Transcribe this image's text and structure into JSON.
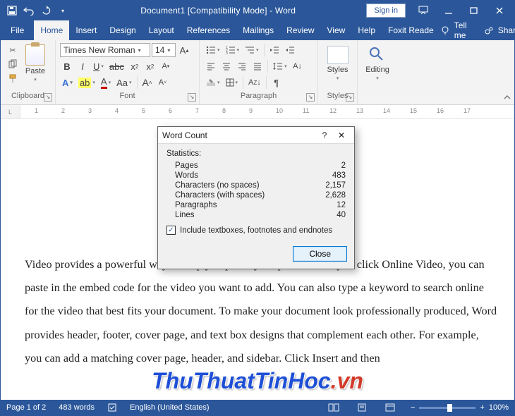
{
  "titlebar": {
    "title": "Document1 [Compatibility Mode]  -  Word",
    "signin": "Sign in"
  },
  "tabs": {
    "file": "File",
    "home": "Home",
    "insert": "Insert",
    "design": "Design",
    "layout": "Layout",
    "references": "References",
    "mailings": "Mailings",
    "review": "Review",
    "view": "View",
    "help": "Help",
    "foxit": "Foxit Reade",
    "tellme": "Tell me",
    "share": "Share"
  },
  "ribbon": {
    "clipboard": {
      "paste": "Paste",
      "label": "Clipboard"
    },
    "font": {
      "name": "Times New Roman",
      "size": "14",
      "label": "Font"
    },
    "paragraph": {
      "label": "Paragraph"
    },
    "styles": {
      "big": "Styles",
      "label": "Styles"
    },
    "editing": {
      "big": "Editing"
    }
  },
  "dialog": {
    "title": "Word Count",
    "statistics": "Statistics:",
    "rows": {
      "pages": {
        "label": "Pages",
        "value": "2"
      },
      "words": {
        "label": "Words",
        "value": "483"
      },
      "chars_nospace": {
        "label": "Characters (no spaces)",
        "value": "2,157"
      },
      "chars_space": {
        "label": "Characters (with spaces)",
        "value": "2,628"
      },
      "paragraphs": {
        "label": "Paragraphs",
        "value": "12"
      },
      "lines": {
        "label": "Lines",
        "value": "40"
      }
    },
    "checkbox": "Include textboxes, footnotes and endnotes",
    "close": "Close"
  },
  "document": {
    "body": "Video provides a powerful way to help you prove your point. When you click Online Video, you can paste in the embed code for the video you want to add. You can also type a keyword to search online for the video that best fits your document. To make your document look professionally produced, Word provides header, footer, cover page, and text box designs that complement each other. For example, you can add a matching cover page, header, and sidebar. Click Insert and then"
  },
  "watermark": {
    "a": "ThuThuatTinHoc",
    "b": ".vn"
  },
  "status": {
    "page": "Page 1 of 2",
    "words": "483 words",
    "lang": "English (United States)",
    "zoom": "100%"
  },
  "ruler_numbers": [
    "1",
    "2",
    "3",
    "4",
    "5",
    "6",
    "7",
    "8",
    "9",
    "10",
    "11",
    "12",
    "13",
    "14",
    "15",
    "16",
    "17"
  ]
}
